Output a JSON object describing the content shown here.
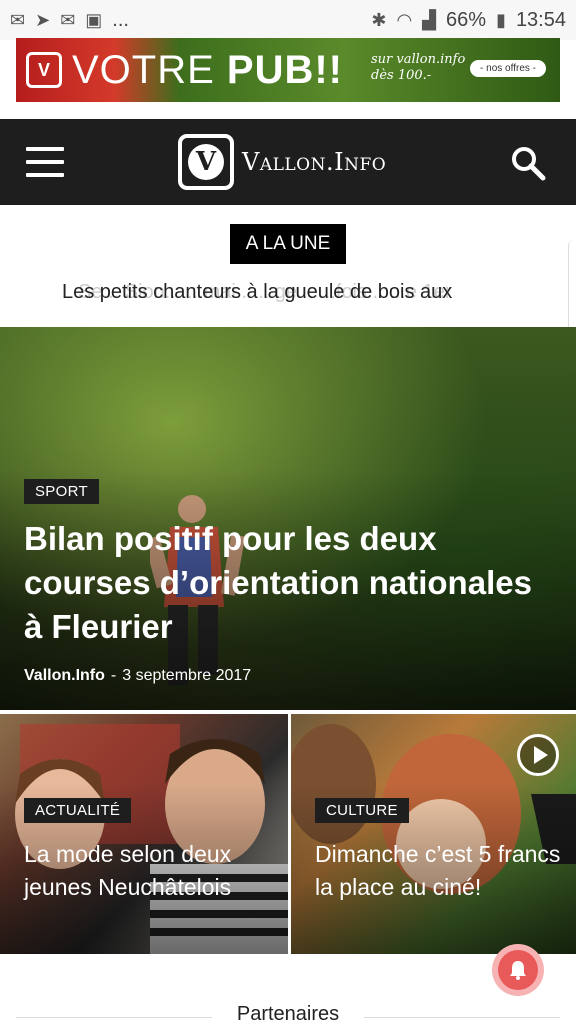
{
  "statusbar": {
    "left_icons": [
      "mail-icon",
      "send-icon",
      "mail-icon",
      "image-icon",
      "more-icon"
    ],
    "more_text": "...",
    "right_icons": [
      "bluetooth-icon",
      "wifi-icon",
      "signal-icon",
      "battery-icon"
    ],
    "battery": "66%",
    "time": "13:54"
  },
  "ad": {
    "headline_regular": "VOTRE ",
    "headline_bold": "PUB!!",
    "tagline": "sur vallon.info dès 100.-",
    "cta": "- nos offres -"
  },
  "header": {
    "menu_icon": "menu-icon",
    "logo_letter": "V",
    "logo_text": "Vallon.Info",
    "search_icon": "search-icon"
  },
  "headlines": {
    "label": "A LA UNE",
    "ticker_text": "Les petits chanteurs à la gueule de bois aux",
    "ticker_ghost": "Se... Sion... ...mai... ...ge... ...fois... ...e 1er"
  },
  "hero": {
    "category": "SPORT",
    "title": "Bilan positif pour les deux courses d’orientation nationales à Fleurier",
    "author": "Vallon.Info",
    "separator": "-",
    "date": "3 septembre 2017"
  },
  "cards": [
    {
      "category": "ACTUALITÉ",
      "title": "La mode selon deux jeunes Neuchâtelois"
    },
    {
      "category": "CULTURE",
      "title": "Dimanche c’est 5 francs la place au ciné!",
      "play_icon": "play-icon"
    }
  ],
  "notification_icon": "bell-icon",
  "partners": {
    "title": "Partenaires"
  }
}
